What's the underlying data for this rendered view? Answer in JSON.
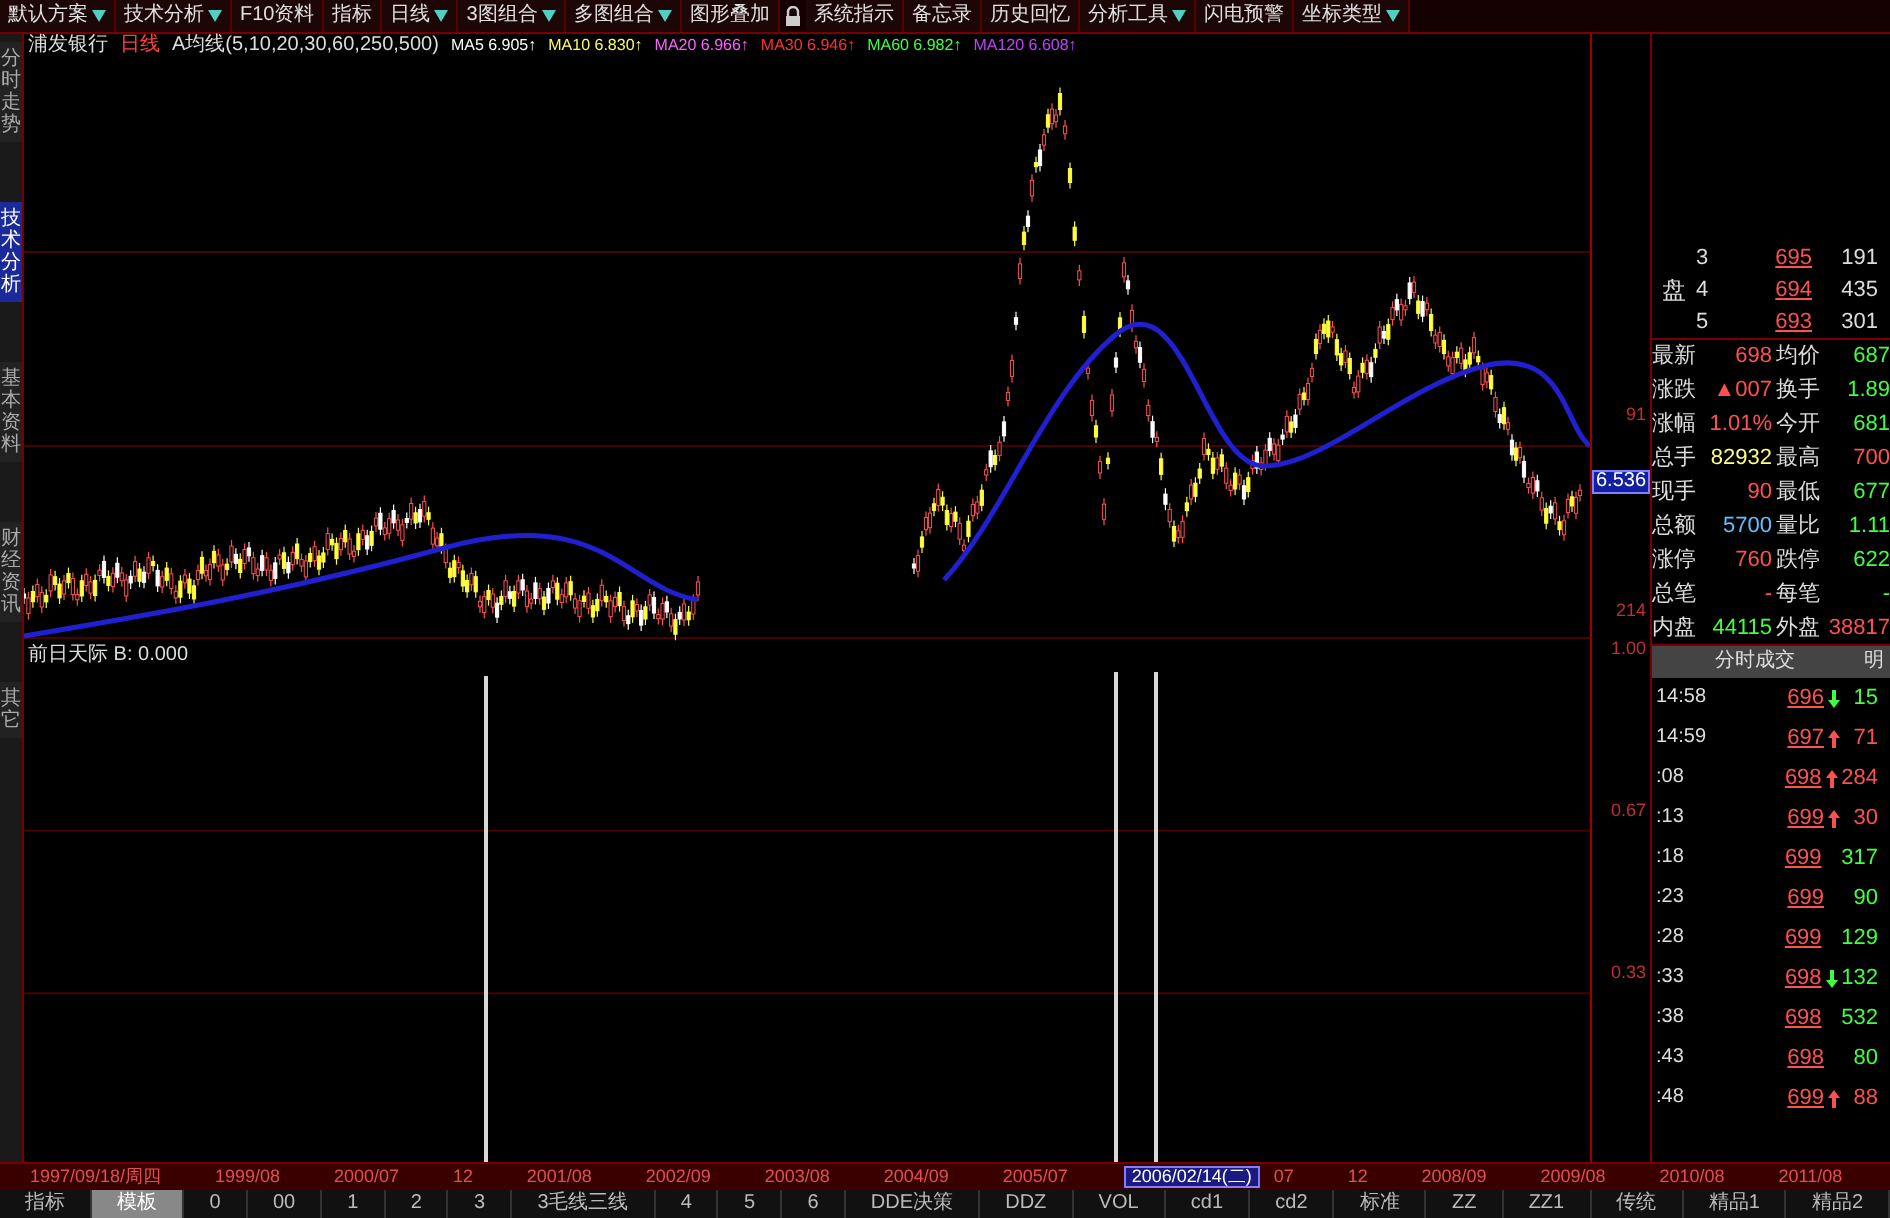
{
  "toolbar": [
    {
      "label": "默认方案",
      "dropdown": true
    },
    {
      "label": "技术分析",
      "dropdown": true
    },
    {
      "label": "F10资料",
      "dropdown": false
    },
    {
      "label": "指标",
      "dropdown": false
    },
    {
      "label": "日线",
      "dropdown": true
    },
    {
      "label": "3图组合",
      "dropdown": true
    },
    {
      "label": "多图组合",
      "dropdown": true
    },
    {
      "label": "图形叠加",
      "dropdown": false
    },
    {
      "label": "系统指示",
      "dropdown": false
    },
    {
      "label": "备忘录",
      "dropdown": false
    },
    {
      "label": "历史回忆",
      "dropdown": false
    },
    {
      "label": "分析工具",
      "dropdown": true
    },
    {
      "label": "闪电预警",
      "dropdown": false
    },
    {
      "label": "坐标类型",
      "dropdown": true
    }
  ],
  "indicator_line": {
    "stock": "浦发银行",
    "period": "日线",
    "formula": "A均线(5,10,20,30,60,250,500)",
    "values": [
      "MA5 6.905↑",
      "MA10 6.830↑",
      "MA20 6.966↑",
      "MA30 6.946↑",
      "MA60 6.982↑",
      "MA120 6.608↑"
    ]
  },
  "side_tabs": [
    {
      "label": "分时走势",
      "selected": false
    },
    {
      "label": "技术分析",
      "selected": true
    },
    {
      "label": "基本资料",
      "selected": false
    },
    {
      "label": "财经资讯",
      "selected": false
    },
    {
      "label": "其它",
      "selected": false
    }
  ],
  "price_axis": [
    "91",
    "6.536",
    "214"
  ],
  "lower_indicator": {
    "label": "前日天际 B: 0.000",
    "axis": [
      "1.00",
      "0.67",
      "0.33"
    ]
  },
  "order_book": {
    "label": "盘",
    "rows": [
      {
        "level": "3",
        "price": "695",
        "volume": "191"
      },
      {
        "level": "4",
        "price": "694",
        "volume": "435"
      },
      {
        "level": "5",
        "price": "693",
        "volume": "301"
      }
    ]
  },
  "quotes": [
    [
      "最新",
      "698",
      "均价",
      "687"
    ],
    [
      "涨跌",
      "▲007",
      "换手",
      "1.89"
    ],
    [
      "涨幅",
      "1.01%",
      "今开",
      "681"
    ],
    [
      "总手",
      "82932",
      "最高",
      "700"
    ],
    [
      "现手",
      "90",
      "最低",
      "677"
    ],
    [
      "总额",
      "5700",
      "量比",
      "1.11"
    ],
    [
      "涨停",
      "760",
      "跌停",
      "622"
    ],
    [
      "总笔",
      "-",
      "每笔",
      "-"
    ],
    [
      "内盘",
      "44115",
      "外盘",
      "38817"
    ]
  ],
  "trades_header": {
    "title": "分时成交",
    "column_2": "明"
  },
  "trades": [
    {
      "time": "14:58",
      "price": "696",
      "up_arrow": false,
      "down_arrow": true,
      "volume": "15",
      "buy": false
    },
    {
      "time": "14:59",
      "price": "697",
      "up_arrow": true,
      "down_arrow": false,
      "volume": "71",
      "buy": true
    },
    {
      "time": ":08",
      "price": "698",
      "up_arrow": true,
      "down_arrow": false,
      "volume": "284",
      "buy": true
    },
    {
      "time": ":13",
      "price": "699",
      "up_arrow": true,
      "down_arrow": false,
      "volume": "30",
      "buy": true
    },
    {
      "time": ":18",
      "price": "699",
      "up_arrow": false,
      "down_arrow": false,
      "volume": "317",
      "buy": false
    },
    {
      "time": ":23",
      "price": "699",
      "up_arrow": false,
      "down_arrow": false,
      "volume": "90",
      "buy": false
    },
    {
      "time": ":28",
      "price": "699",
      "up_arrow": false,
      "down_arrow": false,
      "volume": "129",
      "buy": false
    },
    {
      "time": ":33",
      "price": "698",
      "up_arrow": false,
      "down_arrow": true,
      "volume": "132",
      "buy": false
    },
    {
      "time": ":38",
      "price": "698",
      "up_arrow": false,
      "down_arrow": false,
      "volume": "532",
      "buy": false
    },
    {
      "time": ":43",
      "price": "698",
      "up_arrow": false,
      "down_arrow": false,
      "volume": "80",
      "buy": false
    },
    {
      "time": ":48",
      "price": "699",
      "up_arrow": true,
      "down_arrow": false,
      "volume": "88",
      "buy": true
    }
  ],
  "date_bar": [
    {
      "label": "1997/09/18/周四",
      "selected": false
    },
    {
      "label": "1999/08",
      "selected": false
    },
    {
      "label": "2000/07",
      "selected": false
    },
    {
      "label": "12",
      "selected": false
    },
    {
      "label": "2001/08",
      "selected": false
    },
    {
      "label": "2002/09",
      "selected": false
    },
    {
      "label": "2003/08",
      "selected": false
    },
    {
      "label": "2004/09",
      "selected": false
    },
    {
      "label": "2005/07",
      "selected": false
    },
    {
      "label": "2006/02/14(二)",
      "selected": true
    },
    {
      "label": "07",
      "selected": false
    },
    {
      "label": "12",
      "selected": false
    },
    {
      "label": "2008/09",
      "selected": false
    },
    {
      "label": "2009/08",
      "selected": false
    },
    {
      "label": "2010/08",
      "selected": false
    },
    {
      "label": "2011/08",
      "selected": false
    }
  ],
  "bottom_tabs": [
    {
      "label": "指标",
      "selected": false
    },
    {
      "label": "模板",
      "selected": true
    },
    {
      "label": "0",
      "selected": false
    },
    {
      "label": "00",
      "selected": false
    },
    {
      "label": "1",
      "selected": false
    },
    {
      "label": "2",
      "selected": false
    },
    {
      "label": "3",
      "selected": false
    },
    {
      "label": "3毛线三线",
      "selected": false
    },
    {
      "label": "4",
      "selected": false
    },
    {
      "label": "5",
      "selected": false
    },
    {
      "label": "6",
      "selected": false
    },
    {
      "label": "DDE决策",
      "selected": false
    },
    {
      "label": "DDZ",
      "selected": false
    },
    {
      "label": "VOL",
      "selected": false
    },
    {
      "label": "cd1",
      "selected": false
    },
    {
      "label": "cd2",
      "selected": false
    },
    {
      "label": "标准",
      "selected": false
    },
    {
      "label": "ZZ",
      "selected": false
    },
    {
      "label": "ZZ1",
      "selected": false
    },
    {
      "label": "传统",
      "selected": false
    },
    {
      "label": "精品1",
      "selected": false
    },
    {
      "label": "精品2",
      "selected": false
    }
  ]
}
